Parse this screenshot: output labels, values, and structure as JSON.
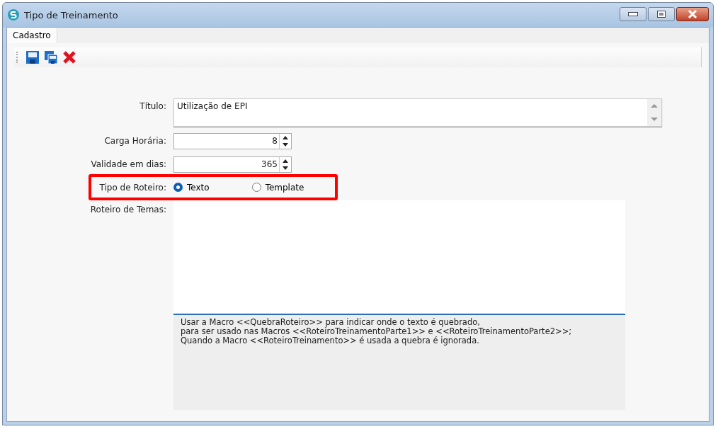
{
  "window": {
    "title": "Tipo de Treinamento"
  },
  "tabs": [
    {
      "label": "Cadastro",
      "selected": true
    }
  ],
  "toolbar": {
    "buttons": [
      {
        "kind": "save"
      },
      {
        "kind": "save-copy"
      },
      {
        "kind": "delete"
      }
    ]
  },
  "form": {
    "title": {
      "label": "Título:",
      "value": "Utilização de EPI"
    },
    "workload": {
      "label": "Carga Horária:",
      "value": "8"
    },
    "validity": {
      "label": "Validade em dias:",
      "value": "365"
    },
    "script_type": {
      "label": "Tipo de Roteiro:",
      "highlighted": true,
      "options": [
        {
          "label": "Texto",
          "selected": true
        },
        {
          "label": "Template",
          "selected": false
        }
      ]
    },
    "topics": {
      "label": "Roteiro de Temas:"
    },
    "help_lines": [
      "Usar a Macro <<QuebraRoteiro>> para indicar onde o texto é quebrado,",
      "para ser usado nas Macros <<RoteiroTreinamentoParte1>> e <<RoteiroTreinamentoParte2>>;",
      "Quando a Macro <<RoteiroTreinamento>> é usada a quebra é ignorada."
    ]
  }
}
